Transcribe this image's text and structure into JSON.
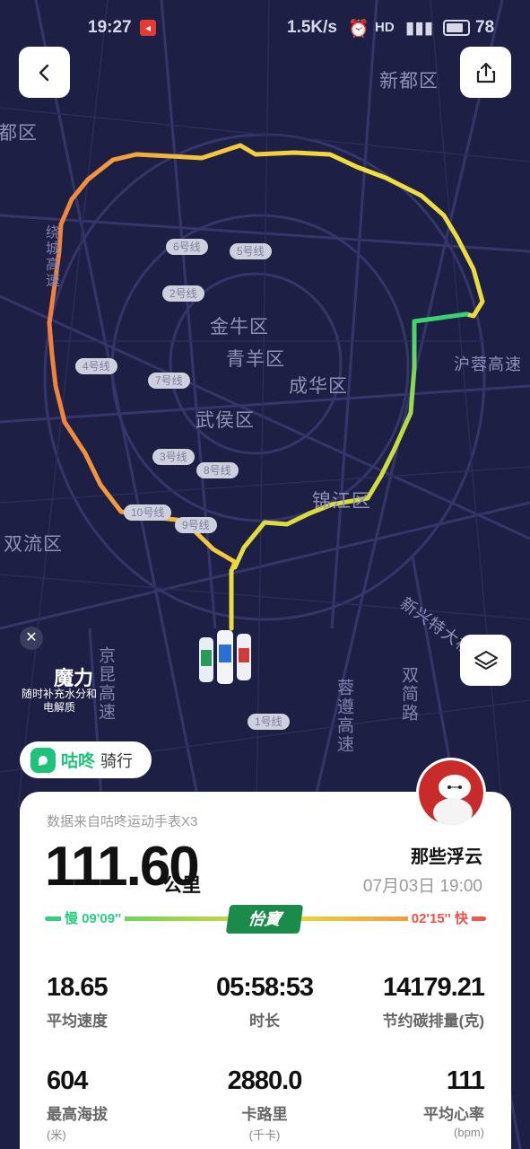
{
  "status_bar": {
    "time": "19:27",
    "network_speed": "1.5K/s",
    "battery": "78"
  },
  "map": {
    "districts": [
      "新都区",
      "郫都区",
      "金牛区",
      "青羊区",
      "成华区",
      "武侯区",
      "锦江区",
      "双流区"
    ],
    "roads": [
      "沪蓉高速",
      "绕城高速",
      "京昆高速",
      "蓉遵高速",
      "双简路",
      "新兴特大桥"
    ],
    "metro_lines": [
      "6号线",
      "5号线",
      "2号线",
      "4号线",
      "7号线",
      "3号线",
      "8号线",
      "10号线",
      "9号线",
      "1号线"
    ],
    "track_colors": [
      "#f0a23c",
      "#f5d23a",
      "#2ccf82"
    ]
  },
  "ad": {
    "title": "魔力",
    "subtitle": "随时补充水分和电解质"
  },
  "brand": {
    "name": "咕咚",
    "mode": "骑行"
  },
  "summary": {
    "source": "数据来自咕咚运动手表X3",
    "distance": "111.60",
    "distance_unit": "公里",
    "username": "那些浮云",
    "datetime": "07月03日 19:00",
    "pace_slow": "慢 09'09''",
    "pace_fast": "02'15'' 快",
    "sponsor": "怡寶"
  },
  "stats": [
    {
      "value": "18.65",
      "label": "平均速度",
      "unit": ""
    },
    {
      "value": "05:58:53",
      "label": "时长",
      "unit": ""
    },
    {
      "value": "14179.21",
      "label": "节约碳排量(克)",
      "unit": ""
    },
    {
      "value": "604",
      "label": "最高海拔",
      "unit": "(米)"
    },
    {
      "value": "2880.0",
      "label": "卡路里",
      "unit": "(千卡)"
    },
    {
      "value": "111",
      "label": "平均心率",
      "unit": "(bpm)"
    }
  ]
}
